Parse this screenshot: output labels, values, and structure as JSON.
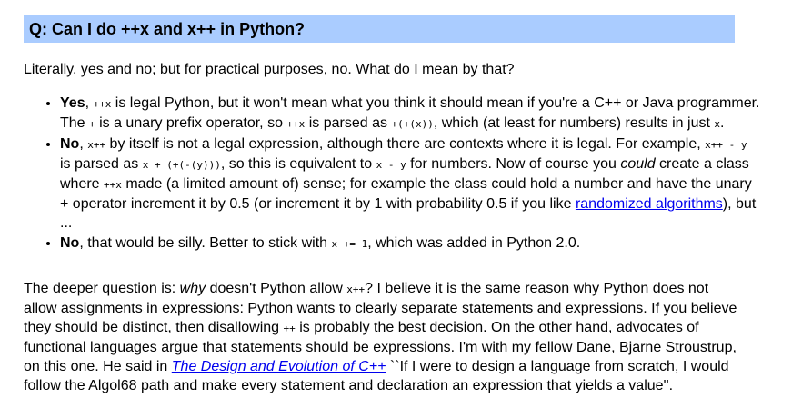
{
  "question": "Q: Can I do ++x and x++ in Python?",
  "intro": "Literally, yes and no; but for practical purposes, no. What do I mean by that?",
  "items": [
    {
      "lead": "Yes",
      "t1": ", ",
      "c1": "++x",
      "t2": " is legal Python, but it won't mean what you think it should mean if you're a C++ or Java programmer. The ",
      "c2": "+",
      "t3": " is a unary prefix operator, so ",
      "c3": "++x",
      "t4": " is parsed as ",
      "c4": "+(+(x))",
      "t5": ", which (at least for numbers) results in just ",
      "c5": "x",
      "t6": "."
    },
    {
      "lead": "No",
      "t1": ", ",
      "c1": "x++",
      "t2": " by itself is not a legal expression, although there are contexts where it is legal. For example, ",
      "c2": "x++ - y",
      "t3": " is parsed as ",
      "c3": "x + (+(-(y)))",
      "t4": ", so this is equivalent to ",
      "c4": "x - y",
      "t5": " for numbers. Now of course you ",
      "em": "could",
      "t6": " create a class where ",
      "c5": "++x",
      "t7": " made (a limited amount of) sense; for example the class could hold a number and have the unary + operator increment it by 0.5 (or increment it by 1 with probability 0.5 if you like ",
      "link": "randomized algorithms",
      "t8": "), but ..."
    },
    {
      "lead": "No",
      "t1": ", that would be silly. Better to stick with ",
      "c1": "x += 1",
      "t2": ", which was added in Python 2.0."
    }
  ],
  "closing": {
    "t1": "The deeper question is: ",
    "em": "why",
    "t2": " doesn't Python allow ",
    "c1": "x++",
    "t3": "? I believe it is the same reason why Python does not allow assignments in expressions: Python wants to clearly separate statements and expressions. If you believe they should be distinct, then disallowing ",
    "c2": "++",
    "t4": " is probably the best decision. On the other hand, advocates of functional languages argue that statements should be expressions. I'm with my fellow Dane, Bjarne Stroustrup, on this one. He said in ",
    "book": "The Design and Evolution of C++",
    "t5": " ``If I were to design a language from scratch, I would follow the Algol68 path and make every statement and declaration an expression that yields a value''."
  },
  "colors": {
    "question_bar": "#aaccff",
    "link": "#0000ee"
  }
}
